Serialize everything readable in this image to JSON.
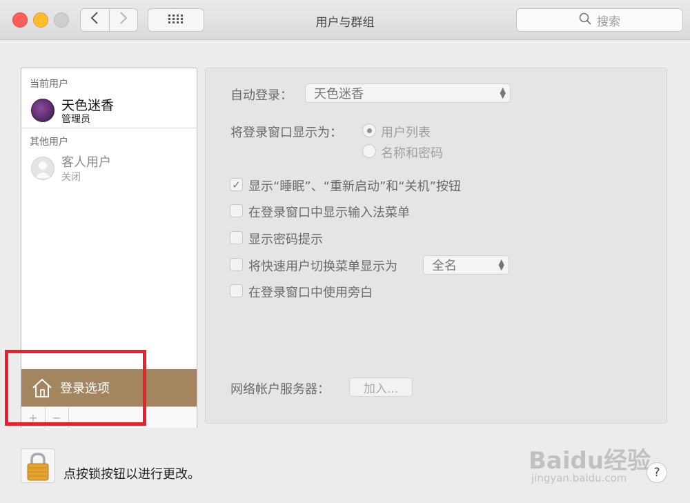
{
  "window": {
    "title": "用户与群组"
  },
  "toolbar": {
    "back_icon": "chevron-left-icon",
    "forward_icon": "chevron-right-icon",
    "grid_icon": "grid-icon",
    "search_placeholder": "搜索"
  },
  "sidebar": {
    "current_users_label": "当前用户",
    "current_user": {
      "name": "天色迷香",
      "role": "管理员"
    },
    "other_users_label": "其他用户",
    "guest_user": {
      "name": "客人用户",
      "status": "关闭"
    },
    "login_options_label": "登录选项",
    "footer_add": "+",
    "footer_remove": "−",
    "selected_color": "#a38660"
  },
  "settings": {
    "auto_login_label": "自动登录：",
    "auto_login_value": "天色迷香",
    "display_as_label": "将登录窗口显示为：",
    "radio_options": [
      {
        "label": "用户列表",
        "selected": true
      },
      {
        "label": "名称和密码",
        "selected": false
      }
    ],
    "checkboxes": [
      {
        "label": "显示“睡眠”、“重新启动”和“关机”按钮",
        "checked": true
      },
      {
        "label": "在登录窗口中显示输入法菜单",
        "checked": false
      },
      {
        "label": "显示密码提示",
        "checked": false
      },
      {
        "label": "将快速用户切换菜单显示为",
        "checked": false
      },
      {
        "label": "在登录窗口中使用旁白",
        "checked": false
      }
    ],
    "fast_switch_value": "全名",
    "network_server_label": "网络帐户服务器：",
    "join_button": "加入..."
  },
  "bottom": {
    "lock_text": "点按锁按钮以进行更改。",
    "help": "?"
  },
  "watermark": {
    "brand": "Baidu经验",
    "url": "jingyan.baidu.com"
  }
}
